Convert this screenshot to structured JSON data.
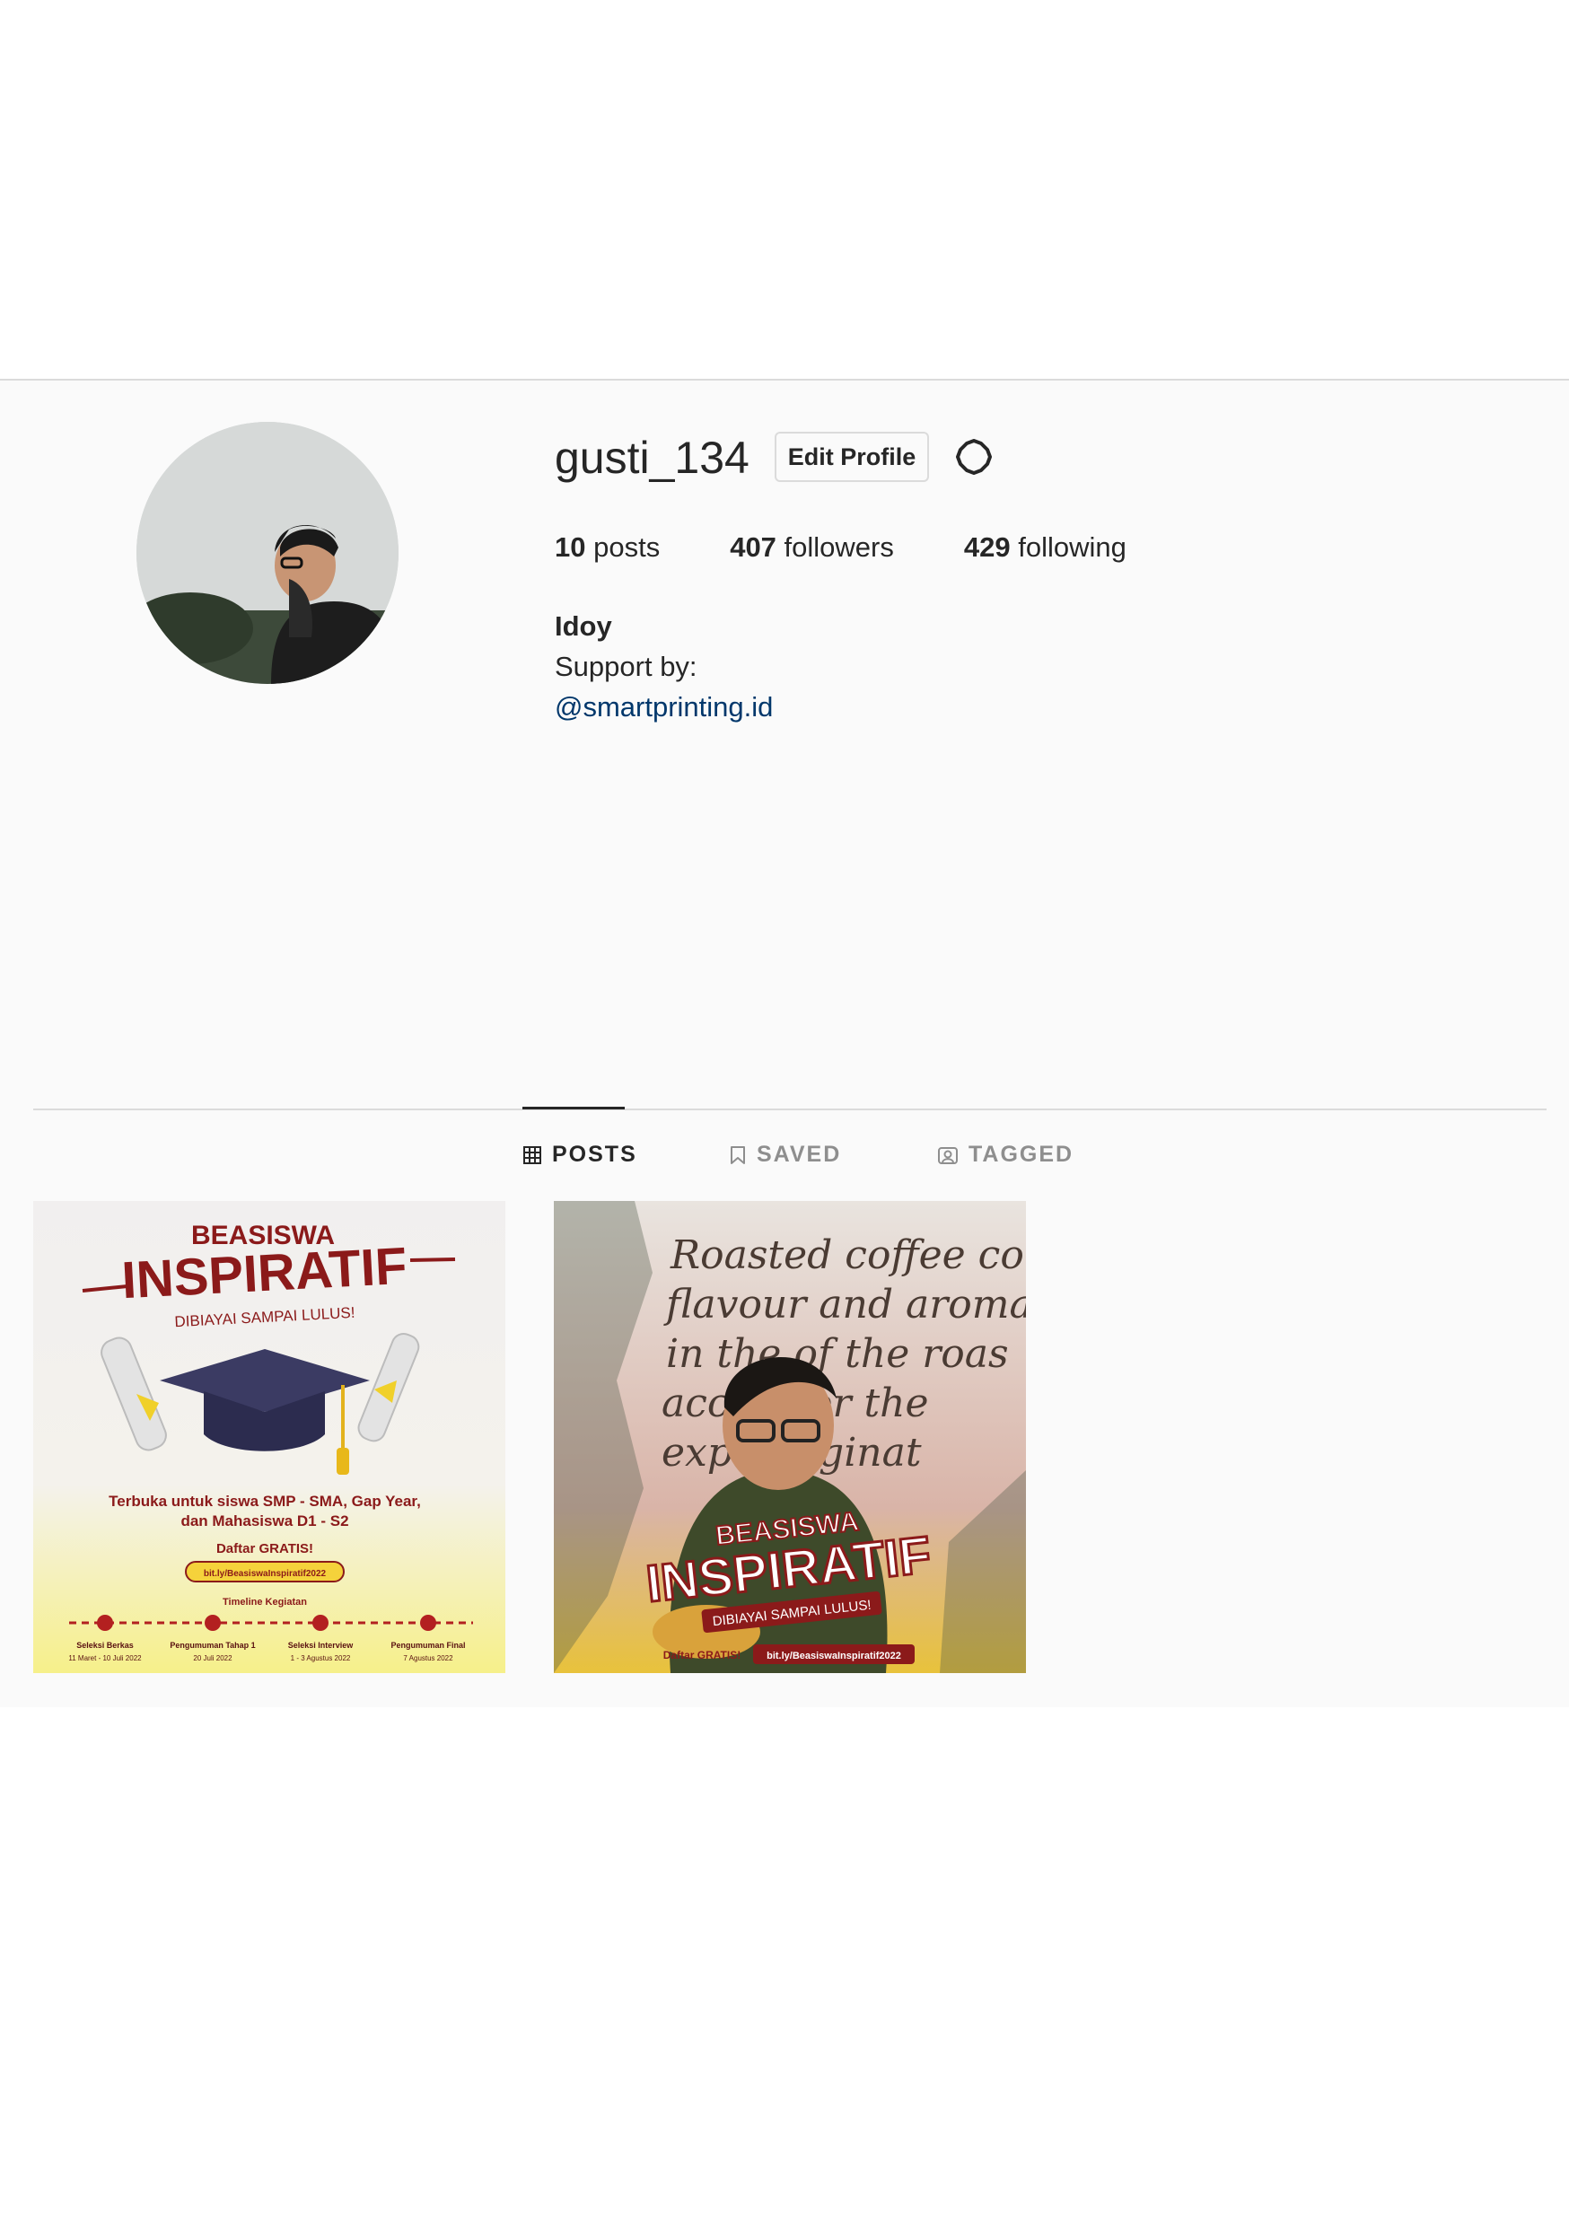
{
  "profile": {
    "username": "gusti_134",
    "edit_label": "Edit Profile",
    "settings_icon": "gear-icon",
    "stats": {
      "posts_count": "10",
      "posts_label": " posts",
      "followers_count": "407",
      "followers_label": " followers",
      "following_count": "429",
      "following_label": " following"
    },
    "bio": {
      "name": "Idoy",
      "line": "Support by:",
      "link": "@smartprinting.id"
    }
  },
  "tabs": [
    {
      "label": "POSTS",
      "icon": "grid-icon",
      "active": true
    },
    {
      "label": "SAVED",
      "icon": "bookmark-icon",
      "active": false
    },
    {
      "label": "TAGGED",
      "icon": "tag-person-icon",
      "active": false
    }
  ],
  "posts": [
    {
      "title_small": "BEASISWA",
      "title_big": "INSPIRATIF",
      "subtitle": "DIBIAYAI SAMPAI LULUS!",
      "text1": "Terbuka untuk siswa SMP - SMA, Gap Year,",
      "text2": "dan Mahasiswa D1 - S2",
      "daftar": "Daftar GRATIS!",
      "link": "bit.ly/BeasiswaInspiratif2022",
      "timeline_label": "Timeline Kegiatan",
      "timeline": [
        {
          "name": "Seleksi Berkas",
          "date": "11 Maret - 10 Juli 2022"
        },
        {
          "name": "Pengumuman Tahap 1",
          "date": "20 Juli 2022"
        },
        {
          "name": "Seleksi Interview",
          "date": "1 - 3 Agustus 2022"
        },
        {
          "name": "Pengumuman Final",
          "date": "7 Agustus 2022"
        }
      ]
    },
    {
      "wall1": "Roasted coffee contains ove",
      "wall2": "flavour and aroma compo",
      "wall3": "in the of the roas",
      "wall4": "acco t for the",
      "wall5": "exp imaginat",
      "title_small": "BEASISWA",
      "title_big": "INSPIRATIF",
      "subtitle": "DIBIAYAI SAMPAI LULUS!",
      "daftar": "Daftar GRATIS!",
      "link": "bit.ly/BeasiswaInspiratif2022"
    }
  ],
  "colors": {
    "text": "#262626",
    "muted": "#8e8e8e",
    "link": "#00376b",
    "border": "#dbdbdb",
    "panel_bg": "#fafafa",
    "brand_red": "#8b1a1a"
  }
}
